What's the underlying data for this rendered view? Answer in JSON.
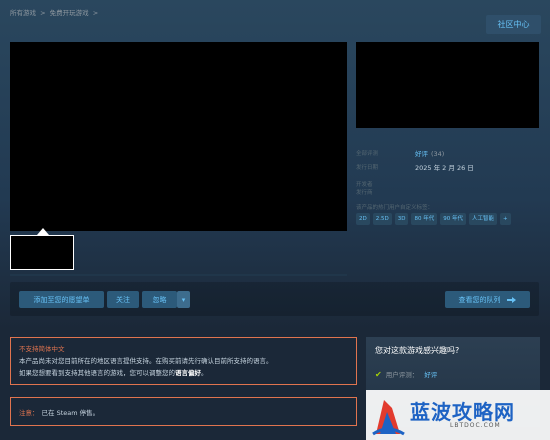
{
  "breadcrumb": [
    "所有游戏",
    ">",
    "免费开玩游戏",
    ">"
  ],
  "header": {
    "community_button": "社区中心"
  },
  "meta": {
    "reviews_label": "全部评测",
    "reviews_value": "好评",
    "reviews_count": "(34)",
    "release_label": "发行日期",
    "release_value": "2025 年 2 月 26 日",
    "developer_label": "开发者",
    "publisher_label": "发行商",
    "tags_label": "该产品的热门用户自定义标签："
  },
  "tags": [
    "2D",
    "2.5D",
    "3D",
    "80 年代",
    "90 年代",
    "人工智能",
    "+"
  ],
  "actions": {
    "wishlist": "添加至您的愿望单",
    "follow": "关注",
    "ignore": "忽略",
    "dropdown": "▾",
    "queue": "查看您的队列"
  },
  "language_warning": {
    "title": "不支持简体中文",
    "line1": "本产品尚未对您目前所在的地区语言提供支持。在购买前请先行确认目前所支持的语言。",
    "line2_pre": "如果您想要看到支持其他语言的游戏，您可以调整您的",
    "line2_bold": "语言偏好",
    "line2_post": "。"
  },
  "note": {
    "label": "注意：",
    "text": "已在 Steam 停售。"
  },
  "interest": {
    "title": "您对这款游戏感兴趣吗?",
    "row_label": "用户评测：",
    "row_value": "好评"
  },
  "watermark": {
    "name": "蓝波攻略网",
    "url": "LBTDOC.COM"
  },
  "colors": {
    "accent": "#67c1f5",
    "warning": "#e0744f",
    "positive": "#a4d007",
    "background": "#1b2838"
  }
}
